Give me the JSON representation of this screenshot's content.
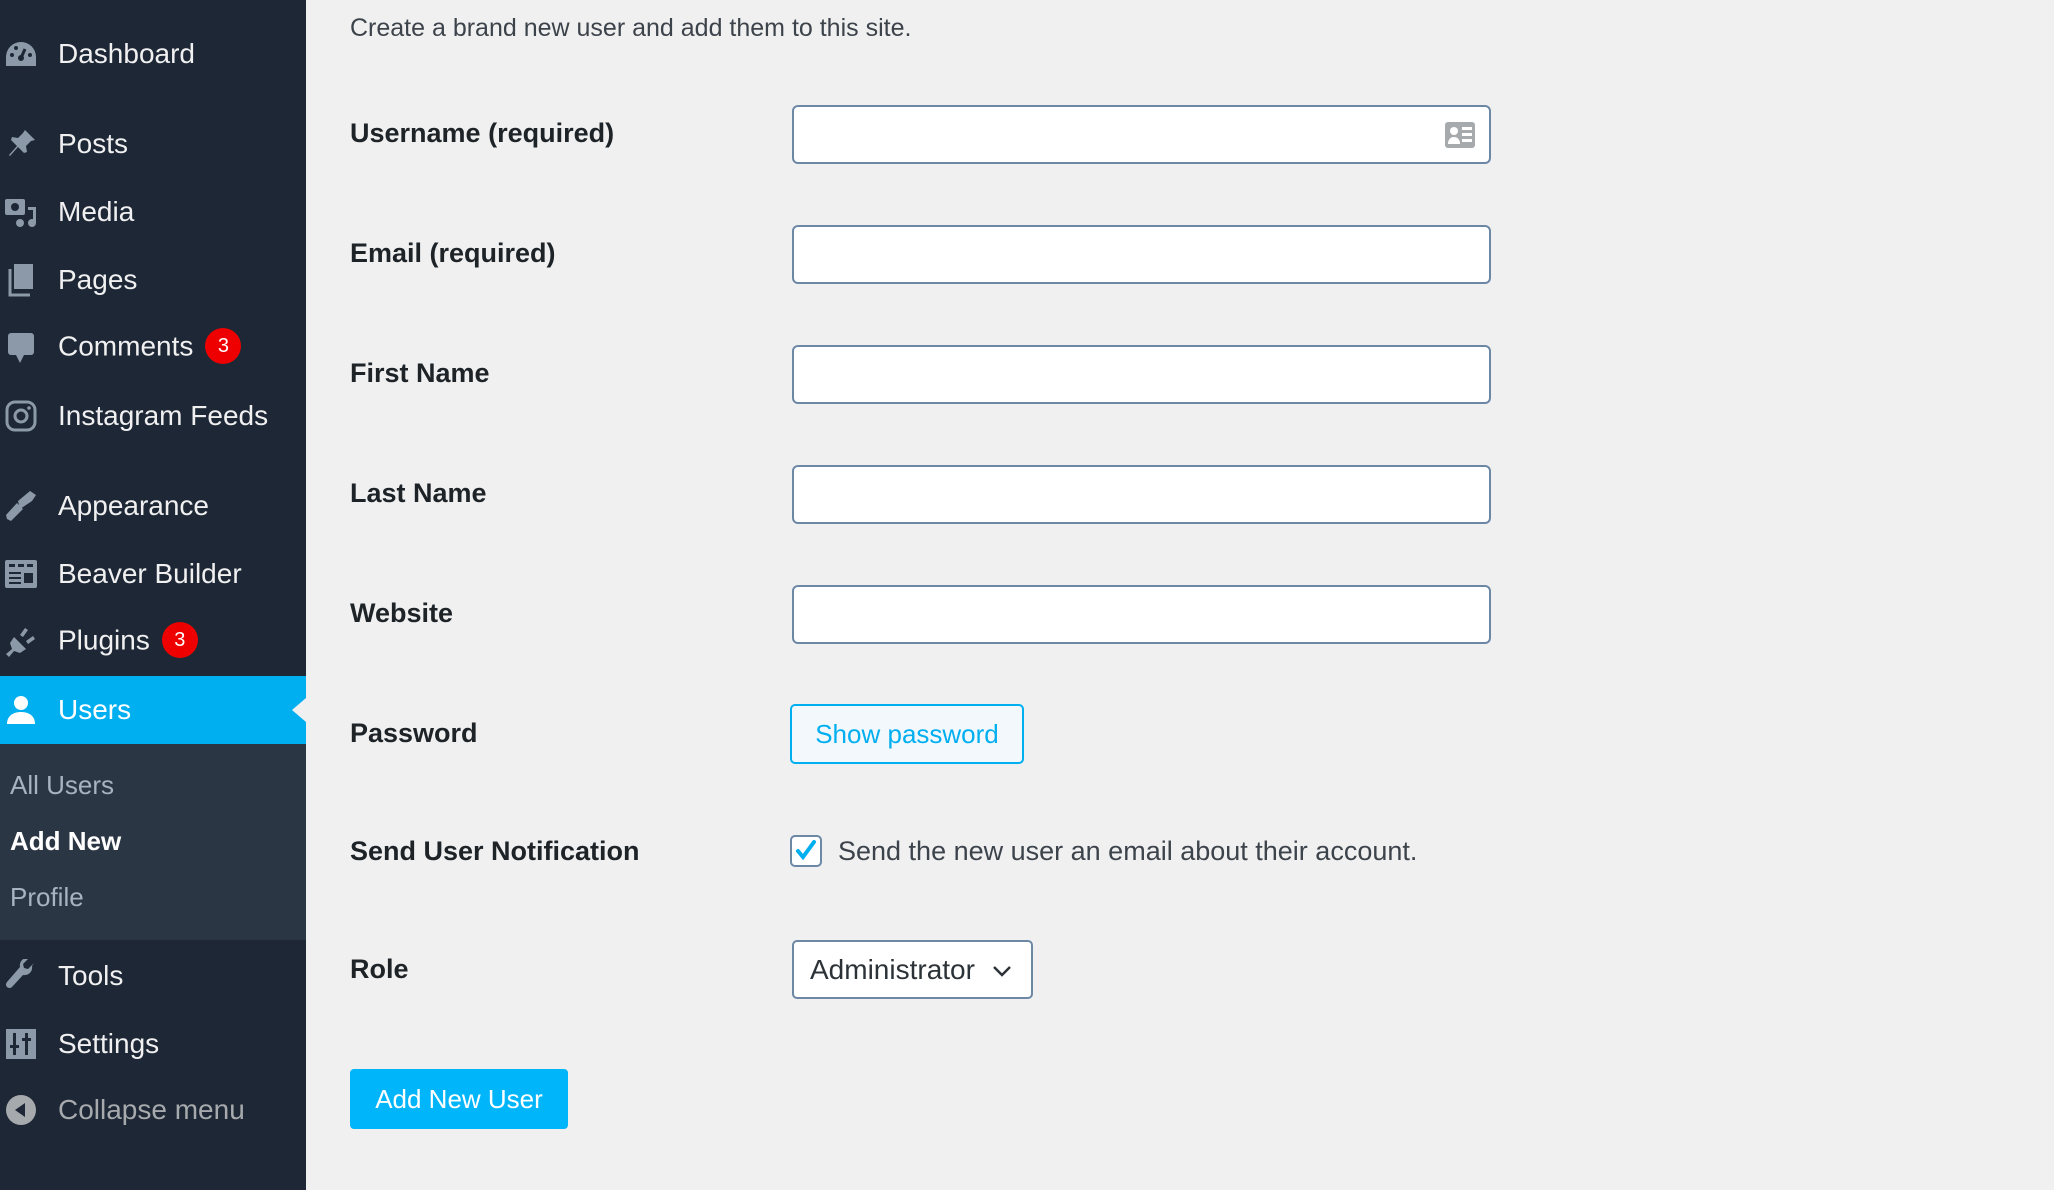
{
  "sidebar": {
    "items": [
      {
        "label": "Dashboard",
        "icon": "dashboard-icon"
      },
      {
        "label": "Posts",
        "icon": "pin-icon"
      },
      {
        "label": "Media",
        "icon": "media-icon"
      },
      {
        "label": "Pages",
        "icon": "pages-icon"
      },
      {
        "label": "Comments",
        "icon": "comment-icon",
        "badge": "3"
      },
      {
        "label": "Instagram Feeds",
        "icon": "instagram-icon"
      },
      {
        "label": "Appearance",
        "icon": "paintbrush-icon"
      },
      {
        "label": "Beaver Builder",
        "icon": "layout-icon"
      },
      {
        "label": "Plugins",
        "icon": "plug-icon",
        "badge": "3"
      },
      {
        "label": "Users",
        "icon": "user-icon",
        "active": true
      },
      {
        "label": "Tools",
        "icon": "wrench-icon"
      },
      {
        "label": "Settings",
        "icon": "sliders-icon"
      },
      {
        "label": "Collapse menu",
        "icon": "collapse-arrow-icon"
      }
    ],
    "submenu": [
      {
        "label": "All Users"
      },
      {
        "label": "Add New",
        "current": true
      },
      {
        "label": "Profile"
      }
    ]
  },
  "colors": {
    "sidebar_bg": "#1d2735",
    "accent": "#00aff0",
    "badge": "#e00000",
    "page_bg": "#f0f0f1"
  },
  "form": {
    "description": "Create a brand new user and add them to this site.",
    "fields": [
      {
        "label": "Username (required)",
        "value": ""
      },
      {
        "label": "Email (required)",
        "value": ""
      },
      {
        "label": "First Name",
        "value": ""
      },
      {
        "label": "Last Name",
        "value": ""
      },
      {
        "label": "Website",
        "value": ""
      }
    ],
    "password": {
      "label": "Password",
      "button": "Show password"
    },
    "notification": {
      "label": "Send User Notification",
      "checkbox_label": "Send the new user an email about their account.",
      "checked": true
    },
    "role": {
      "label": "Role",
      "selected": "Administrator"
    },
    "submit": "Add New User"
  }
}
